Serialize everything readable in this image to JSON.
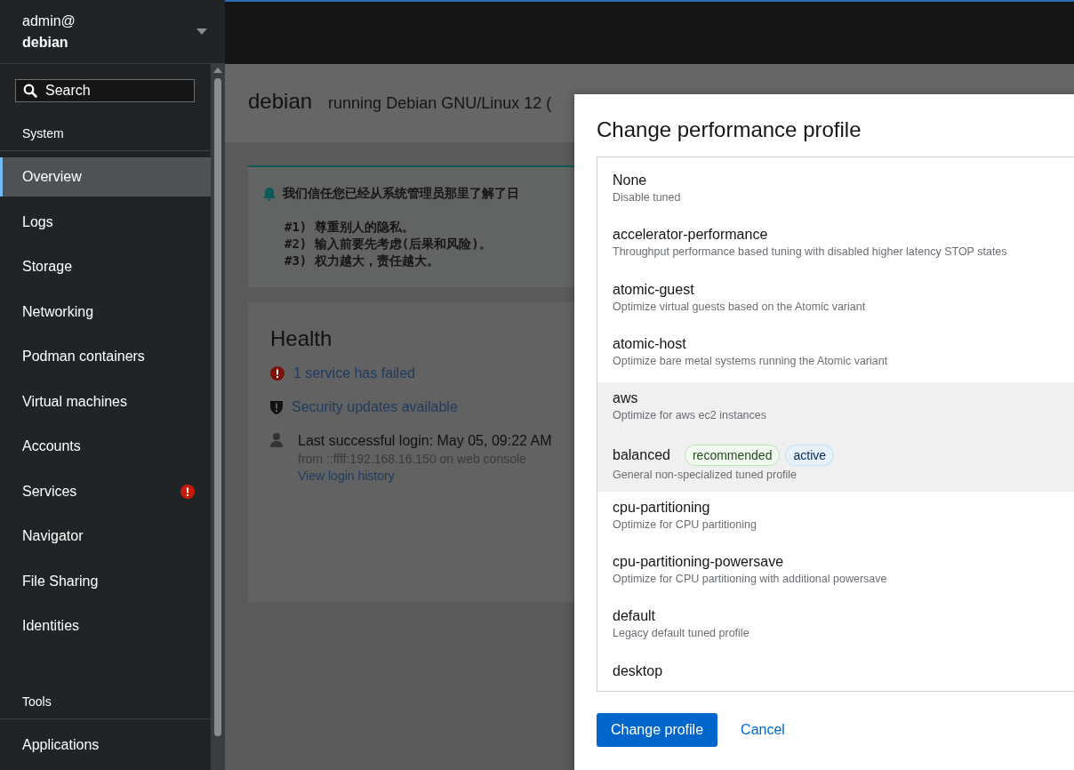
{
  "host_switcher": {
    "user": "admin@",
    "host": "debian"
  },
  "sidebar": {
    "search": {
      "placeholder": "Search"
    },
    "sections": [
      {
        "title": "System",
        "items": [
          {
            "label": "Overview",
            "selected": true,
            "alert": false
          },
          {
            "label": "Logs",
            "selected": false,
            "alert": false
          },
          {
            "label": "Storage",
            "selected": false,
            "alert": false
          },
          {
            "label": "Networking",
            "selected": false,
            "alert": false
          },
          {
            "label": "Podman containers",
            "selected": false,
            "alert": false
          },
          {
            "label": "Virtual machines",
            "selected": false,
            "alert": false
          },
          {
            "label": "Accounts",
            "selected": false,
            "alert": false
          },
          {
            "label": "Services",
            "selected": false,
            "alert": true
          },
          {
            "label": "Navigator",
            "selected": false,
            "alert": false
          },
          {
            "label": "File Sharing",
            "selected": false,
            "alert": false
          },
          {
            "label": "Identities",
            "selected": false,
            "alert": false
          }
        ]
      },
      {
        "title": "Tools",
        "items": [
          {
            "label": "Applications",
            "selected": false,
            "alert": false
          }
        ]
      }
    ]
  },
  "page": {
    "title": "debian",
    "subtitle": "running Debian GNU/Linux 12 (",
    "notice": {
      "lines": [
        "我们信任您已经从系统管理员那里了解了日",
        "#1) 尊重别人的隐私。",
        "#2) 输入前要先考虑(后果和风险)。",
        "#3) 权力越大，责任越大。"
      ]
    },
    "health": {
      "title": "Health",
      "items": [
        {
          "kind": "error",
          "text": "1 service has failed"
        },
        {
          "kind": "security",
          "text": "Security updates available"
        }
      ],
      "login": {
        "text": "Last successful login: May 05, 09:22 AM",
        "detail": "from ::ffff:192.168.16.150 on web console",
        "link": "View login history"
      }
    }
  },
  "dialog": {
    "title": "Change performance profile",
    "profiles": [
      {
        "name": "None",
        "description": "Disable tuned",
        "highlighted": false
      },
      {
        "name": "accelerator-performance",
        "description": "Throughput performance based tuning with disabled higher latency STOP states",
        "highlighted": false
      },
      {
        "name": "atomic-guest",
        "description": "Optimize virtual guests based on the Atomic variant",
        "highlighted": false
      },
      {
        "name": "atomic-host",
        "description": "Optimize bare metal systems running the Atomic variant",
        "highlighted": false
      },
      {
        "name": "aws",
        "description": "Optimize for aws ec2 instances",
        "highlighted": true
      },
      {
        "name": "balanced",
        "description": "General non-specialized tuned profile",
        "highlighted": true,
        "badges": [
          {
            "kind": "recommended",
            "label": "recommended"
          },
          {
            "kind": "active",
            "label": "active"
          }
        ]
      },
      {
        "name": "cpu-partitioning",
        "description": "Optimize for CPU partitioning",
        "highlighted": false
      },
      {
        "name": "cpu-partitioning-powersave",
        "description": "Optimize for CPU partitioning with additional powersave",
        "highlighted": false
      },
      {
        "name": "default",
        "description": "Legacy default tuned profile",
        "highlighted": false
      },
      {
        "name": "desktop",
        "highlighted": false
      }
    ],
    "primary_button": "Change profile",
    "cancel_button": "Cancel"
  }
}
